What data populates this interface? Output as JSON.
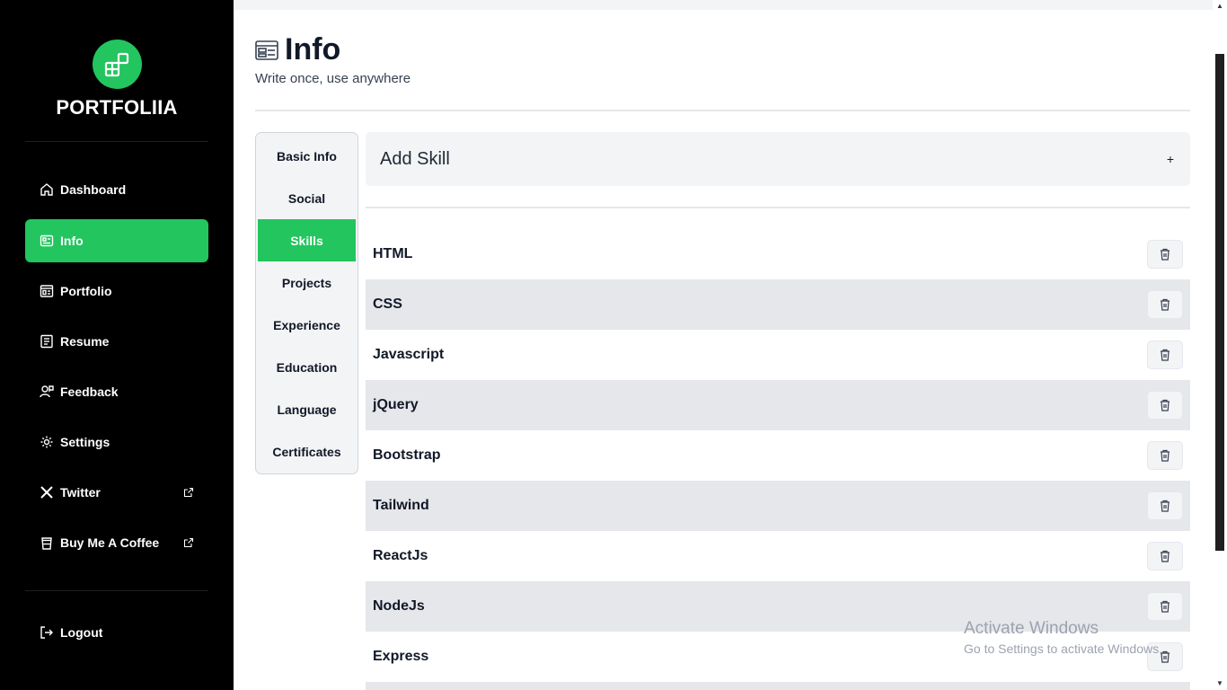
{
  "brand": {
    "name": "PORTFOLIIA",
    "accent_color": "#22c55e"
  },
  "sidebar": {
    "items": [
      {
        "label": "Dashboard",
        "icon": "home-icon"
      },
      {
        "label": "Info",
        "icon": "info-card-icon",
        "active": true
      },
      {
        "label": "Portfolio",
        "icon": "portfolio-icon"
      },
      {
        "label": "Resume",
        "icon": "resume-icon"
      },
      {
        "label": "Feedback",
        "icon": "feedback-icon"
      },
      {
        "label": "Settings",
        "icon": "settings-icon"
      },
      {
        "label": "Twitter",
        "icon": "x-icon",
        "external": true
      },
      {
        "label": "Buy Me A Coffee",
        "icon": "coffee-icon",
        "external": true
      }
    ],
    "logout": {
      "label": "Logout",
      "icon": "logout-icon"
    }
  },
  "page": {
    "title": "Info",
    "subtitle": "Write once, use anywhere"
  },
  "tabs": [
    {
      "label": "Basic Info"
    },
    {
      "label": "Social"
    },
    {
      "label": "Skills",
      "active": true
    },
    {
      "label": "Projects"
    },
    {
      "label": "Experience"
    },
    {
      "label": "Education"
    },
    {
      "label": "Language"
    },
    {
      "label": "Certificates"
    }
  ],
  "add_skill": {
    "label": "Add Skill",
    "plus": "+"
  },
  "skills": [
    "HTML",
    "CSS",
    "Javascript",
    "jQuery",
    "Bootstrap",
    "Tailwind",
    "ReactJs",
    "NodeJs",
    "Express"
  ],
  "watermark": {
    "line1": "Activate Windows",
    "line2": "Go to Settings to activate Windows."
  }
}
